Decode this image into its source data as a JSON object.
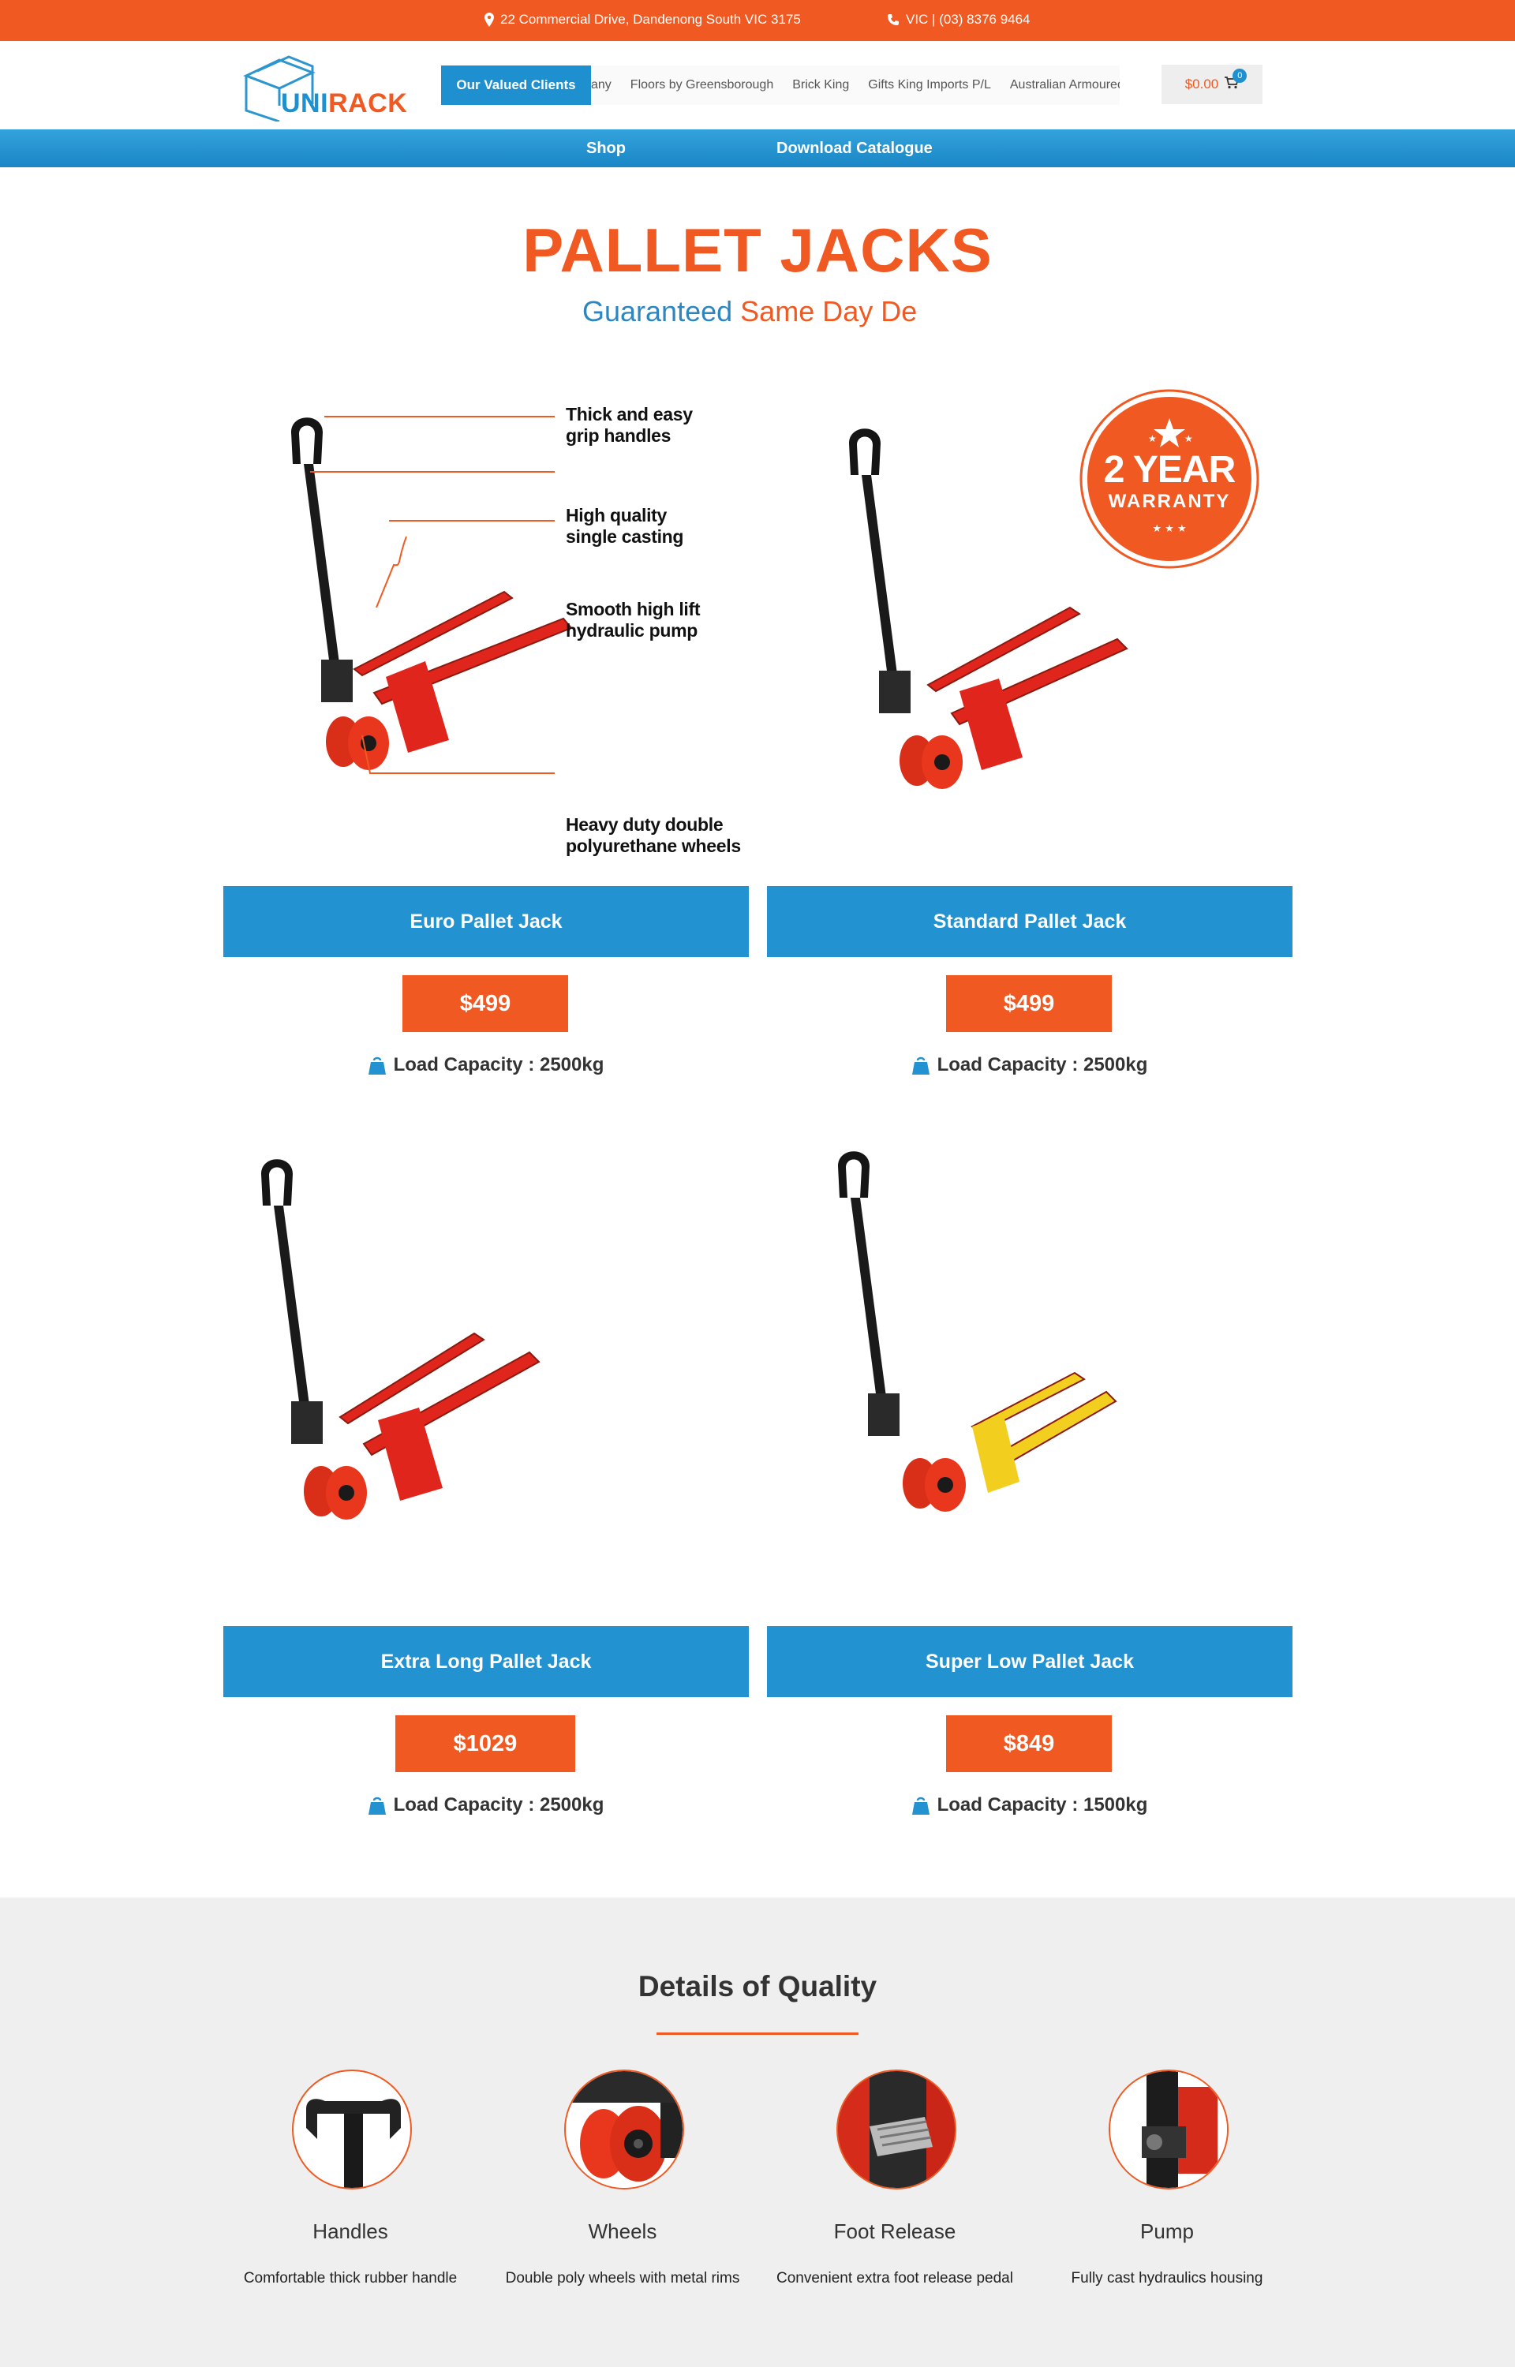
{
  "topbar": {
    "address": "22 Commercial Drive, Dandenong South VIC 3175",
    "phone": "VIC | (03) 8376 9464",
    "location_icon": "map-pin-icon",
    "phone_icon": "phone-icon"
  },
  "header": {
    "logo_uni": "UNI",
    "logo_rack": "RACK",
    "clients_label": "Our Valued Clients",
    "clients": [
      "any",
      "Floors by Greensborough",
      "Brick King",
      "Gifts King Imports P/L",
      "Australian Armoured"
    ],
    "cart_total": "$0.00",
    "cart_count": "0",
    "cart_icon": "shopping-cart-icon"
  },
  "nav": {
    "shop": "Shop",
    "catalogue": "Download Catalogue"
  },
  "hero": {
    "title": "PALLET JACKS",
    "sub_guaranteed": "Guaranteed",
    "sub_sameday": "Same Day De"
  },
  "products": [
    {
      "name": "Euro Pallet Jack",
      "price": "$499",
      "load": "Load Capacity : 2500kg",
      "color": "#e0261c",
      "callouts": [
        "Thick and easy\ngrip handles",
        "High quality\nsingle casting",
        "Smooth high lift\nhydraulic pump",
        "Heavy duty double\npolyurethane wheels"
      ]
    },
    {
      "name": "Standard Pallet Jack",
      "price": "$499",
      "load": "Load Capacity : 2500kg",
      "color": "#e0261c",
      "badge_big": "2 YEAR",
      "badge_small": "WARRANTY"
    },
    {
      "name": "Extra Long Pallet Jack",
      "price": "$1029",
      "load": "Load Capacity : 2500kg",
      "color": "#e0261c"
    },
    {
      "name": "Super Low Pallet Jack",
      "price": "$849",
      "load": "Load Capacity : 1500kg",
      "color": "#f2cf1e"
    }
  ],
  "quality": {
    "title": "Details of Quality",
    "features": [
      {
        "name": "Handles",
        "desc": "Comfortable thick rubber handle"
      },
      {
        "name": "Wheels",
        "desc": "Double poly wheels with metal rims"
      },
      {
        "name": "Foot Release",
        "desc": "Convenient extra foot release pedal"
      },
      {
        "name": "Pump",
        "desc": "Fully cast hydraulics housing"
      }
    ]
  },
  "colors": {
    "brand_orange": "#f05a22",
    "brand_blue": "#2292d0"
  }
}
